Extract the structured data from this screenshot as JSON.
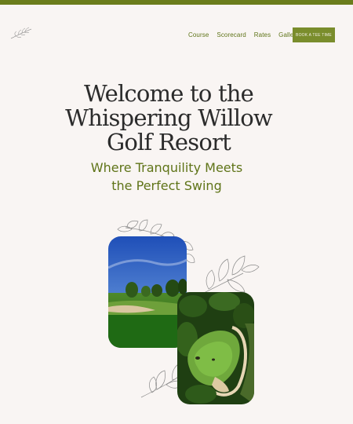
{
  "header": {
    "logo_icon": "willow-branch-logo-icon",
    "nav": [
      {
        "label": "Course"
      },
      {
        "label": "Scorecard"
      },
      {
        "label": "Rates"
      },
      {
        "label": "Gallery"
      }
    ],
    "cta_label": "BOOK A TEE TIME"
  },
  "hero": {
    "title_line1": "Welcome to the",
    "title_line2": "Whispering Willow",
    "title_line3": "Golf Resort",
    "subtitle_line1": "Where Tranquility Meets",
    "subtitle_line2": "the Perfect Swing"
  },
  "images": [
    {
      "name": "fairway-photo",
      "icon": "golf-fairway-image"
    },
    {
      "name": "green-aerial-photo",
      "icon": "golf-green-aerial-image"
    }
  ],
  "colors": {
    "accent": "#6b7d1c",
    "button": "#7a8d2c",
    "background": "#f9f5f3",
    "text": "#2b2b2b"
  }
}
